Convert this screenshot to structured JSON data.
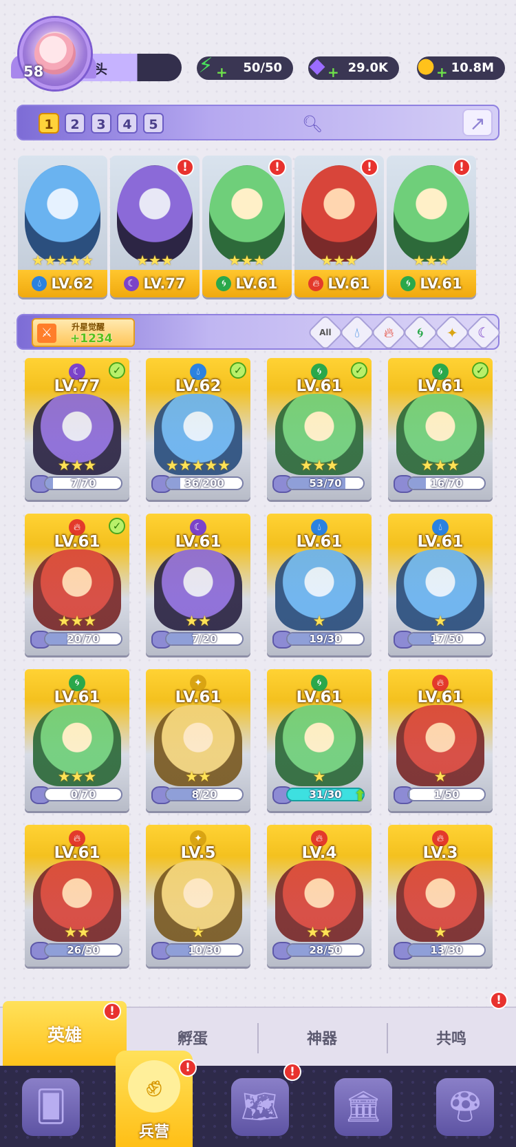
{
  "player": {
    "level": "58",
    "name": "木头"
  },
  "resources": [
    {
      "icon": "lightning-icon",
      "value": "50/50"
    },
    {
      "icon": "gem-icon",
      "value": "29.0K"
    },
    {
      "icon": "coin-icon",
      "value": "10.8M"
    }
  ],
  "team_tabs": [
    "1",
    "2",
    "3",
    "4",
    "5"
  ],
  "team": [
    {
      "element": "water",
      "level": "LV.62",
      "stars": "★★★★★"
    },
    {
      "element": "dark",
      "level": "LV.77",
      "stars": "★★★"
    },
    {
      "element": "wind",
      "level": "LV.61",
      "stars": "★★★"
    },
    {
      "element": "fire",
      "level": "LV.61",
      "stars": "★★★"
    },
    {
      "element": "wind",
      "level": "LV.61",
      "stars": "★★★"
    }
  ],
  "awaken": {
    "title": "升星觉醒",
    "value": "+1234"
  },
  "filters": {
    "all": "All"
  },
  "heroes": [
    {
      "element": "dark",
      "level": "LV.77",
      "stars": "★★★",
      "shards": "7/70",
      "progress": 0.1,
      "checked": true
    },
    {
      "element": "water",
      "level": "LV.62",
      "stars": "★★★★★",
      "shards": "36/200",
      "progress": 0.18,
      "checked": true
    },
    {
      "element": "wind",
      "level": "LV.61",
      "stars": "★★★",
      "shards": "53/70",
      "progress": 0.76,
      "checked": true
    },
    {
      "element": "wind",
      "level": "LV.61",
      "stars": "★★★",
      "shards": "16/70",
      "progress": 0.23,
      "checked": true
    },
    {
      "element": "fire",
      "level": "LV.61",
      "stars": "★★★",
      "shards": "20/70",
      "progress": 0.29,
      "checked": true
    },
    {
      "element": "dark",
      "level": "LV.61",
      "stars": "★★",
      "shards": "7/20",
      "progress": 0.35,
      "checked": false
    },
    {
      "element": "water",
      "level": "LV.61",
      "stars": "★",
      "shards": "19/30",
      "progress": 0.63,
      "checked": false
    },
    {
      "element": "water",
      "level": "LV.61",
      "stars": "★",
      "shards": "17/50",
      "progress": 0.34,
      "checked": false
    },
    {
      "element": "wind",
      "level": "LV.61",
      "stars": "★★★",
      "shards": "0/70",
      "progress": 0.0,
      "checked": false
    },
    {
      "element": "light",
      "level": "LV.61",
      "stars": "★★",
      "shards": "8/20",
      "progress": 0.4,
      "checked": false
    },
    {
      "element": "wind",
      "level": "LV.61",
      "stars": "★",
      "shards": "31/30",
      "progress": 1.0,
      "checked": false,
      "upgrade": true
    },
    {
      "element": "fire",
      "level": "LV.61",
      "stars": "★",
      "shards": "1/50",
      "progress": 0.02,
      "checked": false
    },
    {
      "element": "fire",
      "level": "LV.61",
      "stars": "★★",
      "shards": "26/50",
      "progress": 0.52,
      "checked": false
    },
    {
      "element": "light",
      "level": "LV.5",
      "stars": "★",
      "shards": "10/30",
      "progress": 0.33,
      "checked": false
    },
    {
      "element": "fire",
      "level": "LV.4",
      "stars": "★★",
      "shards": "28/50",
      "progress": 0.56,
      "checked": false
    },
    {
      "element": "fire",
      "level": "LV.3",
      "stars": "★",
      "shards": "13/30",
      "progress": 0.43,
      "checked": false
    }
  ],
  "tabs": [
    {
      "label": "英雄",
      "alert": "!"
    },
    {
      "label": "孵蛋"
    },
    {
      "label": "神器"
    },
    {
      "label": "共鸣",
      "alert": "!"
    }
  ],
  "nav": {
    "active_label": "兵营",
    "alert": "!"
  },
  "colors": {
    "accent": "#ffc21b",
    "panel": "#8f80e0",
    "nav_bg": "#2e2a4a"
  }
}
